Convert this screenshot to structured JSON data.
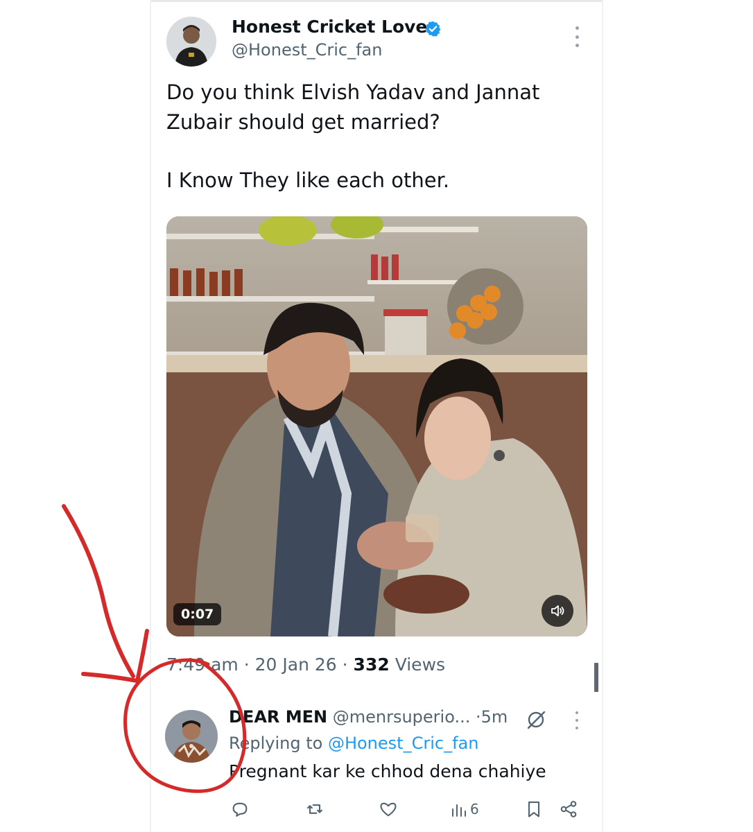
{
  "tweet": {
    "display_name": "Honest Cricket Lover",
    "handle": "@Honest_Cric_fan",
    "text_line_1": "Do you think Elvish Yadav and Jannat Zubair should get married?",
    "text_line_2": "I Know They like each other.",
    "video_duration": "0:07",
    "time": "7:49 am",
    "date": "20 Jan 26",
    "views_count": "332",
    "views_label": "Views",
    "separator": "·"
  },
  "reply": {
    "display_name": "DEAR MEN",
    "handle": "@menrsuperio...",
    "age": "5m",
    "replying_prefix": "Replying to",
    "replying_handle": "@Honest_Cric_fan",
    "text": "Pregnant kar ke chhod dena chahiye",
    "views_count": "6"
  },
  "icons": {
    "verified": "verified-badge-icon",
    "more": "more-dots-icon",
    "sound": "speaker-icon",
    "muted": "muted-icon",
    "reply": "comment-icon",
    "retweet": "retweet-icon",
    "like": "heart-icon",
    "views": "analytics-icon",
    "bookmark": "bookmark-icon",
    "share": "share-icon"
  },
  "colors": {
    "accent": "#1d9bf0",
    "annotation": "#d42a2a",
    "secondary_text": "#536471"
  }
}
